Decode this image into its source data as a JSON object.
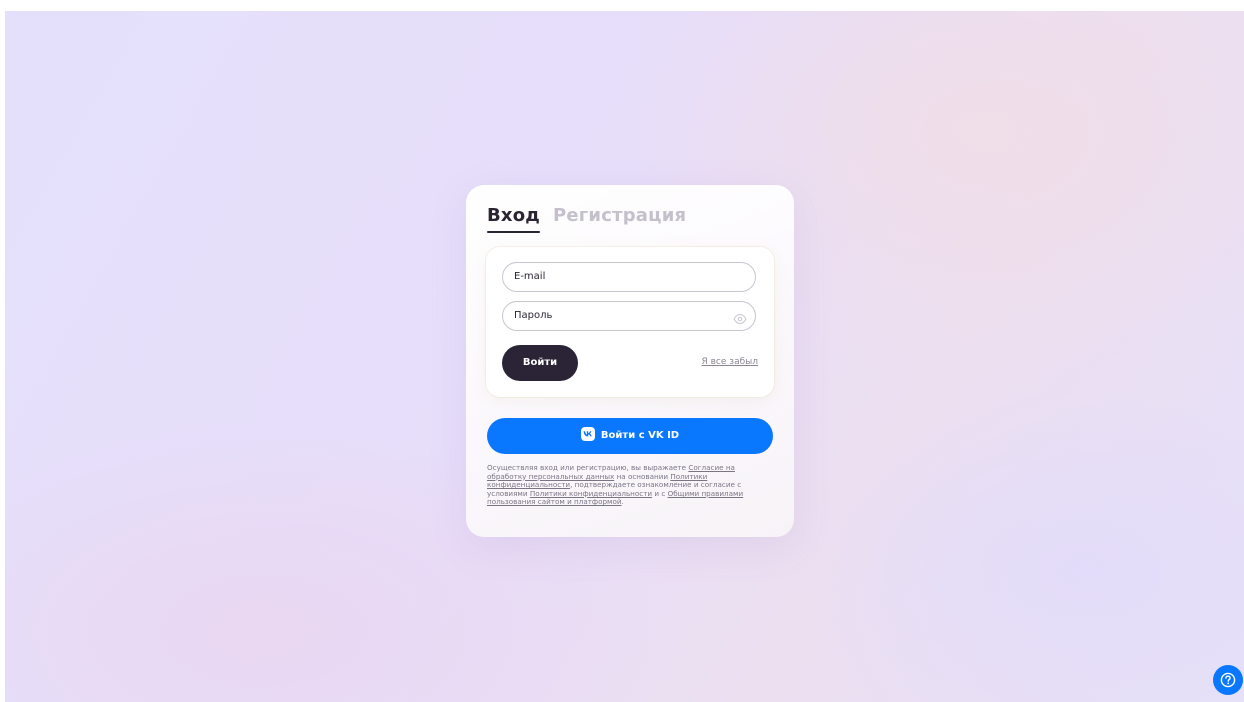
{
  "tabs": {
    "login": "Вход",
    "register": "Регистрация"
  },
  "form": {
    "email_label": "E-mail",
    "password_label": "Пароль",
    "password_toggle_icon": "eye-icon",
    "login_button": "Войти",
    "forgot_link": "Я все забыл"
  },
  "vk": {
    "button_label": "Войти с VK ID",
    "icon": "vk-logo-icon"
  },
  "legal": {
    "part1": "Осуществляя вход или регистрацию, вы выражаете ",
    "link1": "Согласие на обработку персональных данных",
    "part2": " на основании ",
    "link2": "Политики конфиденциальности",
    "part3": ", подтверждаете ознакомление и согласие с условиями ",
    "link3": "Политики конфиденциальности",
    "part4": " и с ",
    "link4": "Общими правилами пользования сайтом и платформой",
    "part5": "."
  },
  "help": {
    "icon": "help-question-icon"
  },
  "colors": {
    "accent_blue": "#0a77ff",
    "dark_button": "#2a2436",
    "active_tab": "#2a2433",
    "inactive_tab": "#c4c0cc"
  }
}
